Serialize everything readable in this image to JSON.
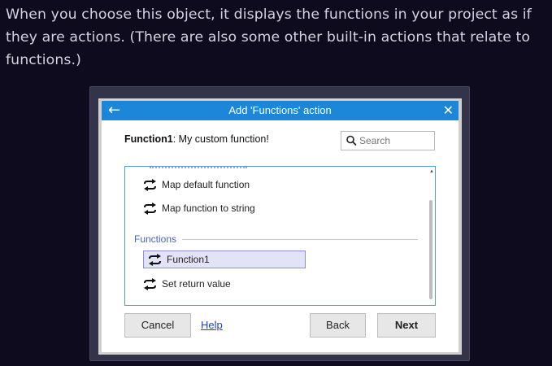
{
  "intro_text": "When you choose this object, it displays the functions in your project as if they are actions. (There are also some other built-in actions that relate to functions.)",
  "dialog": {
    "back_glyph": "←",
    "title": "Add 'Functions' action",
    "close_glyph": "✕",
    "function_name": "Function1",
    "function_description": ": My custom function!",
    "search_placeholder": "Search",
    "items_above": [
      "Map default function",
      "Map function to string"
    ],
    "group_label": "Functions",
    "group_items": [
      "Function1",
      "Set return value"
    ],
    "selected_item": "Function1",
    "buttons": {
      "cancel": "Cancel",
      "help": "Help",
      "back": "Back",
      "next": "Next"
    }
  },
  "colors": {
    "page_background": "#0d0b1d",
    "titlebar": "#1c86d8",
    "accent_border": "#5a98d8",
    "selection": "#e3e3f8",
    "link": "#1a3fd8"
  },
  "icons": {
    "back": "arrow-left-icon",
    "close": "close-icon",
    "search": "search-icon",
    "action": "loop-arrows-icon"
  }
}
